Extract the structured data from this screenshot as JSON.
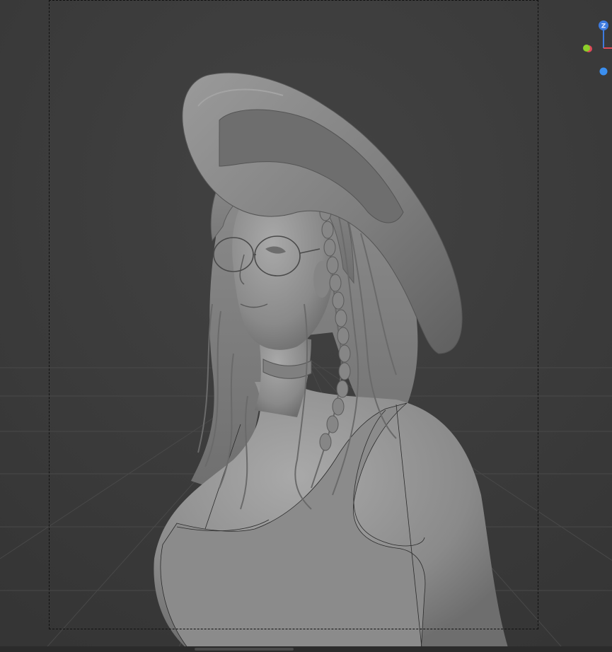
{
  "viewport": {
    "background": "#3a3a3a",
    "grid_color": "#4a4a4a",
    "model_color": "#8f8f8f",
    "frame_color": "#111111"
  },
  "gizmo": {
    "z_label": "Z",
    "z_color": "#3d7be0",
    "x_color": "#e04a5a",
    "y_color": "#8ccf2a",
    "view_dot_color": "#3b8ff0"
  }
}
